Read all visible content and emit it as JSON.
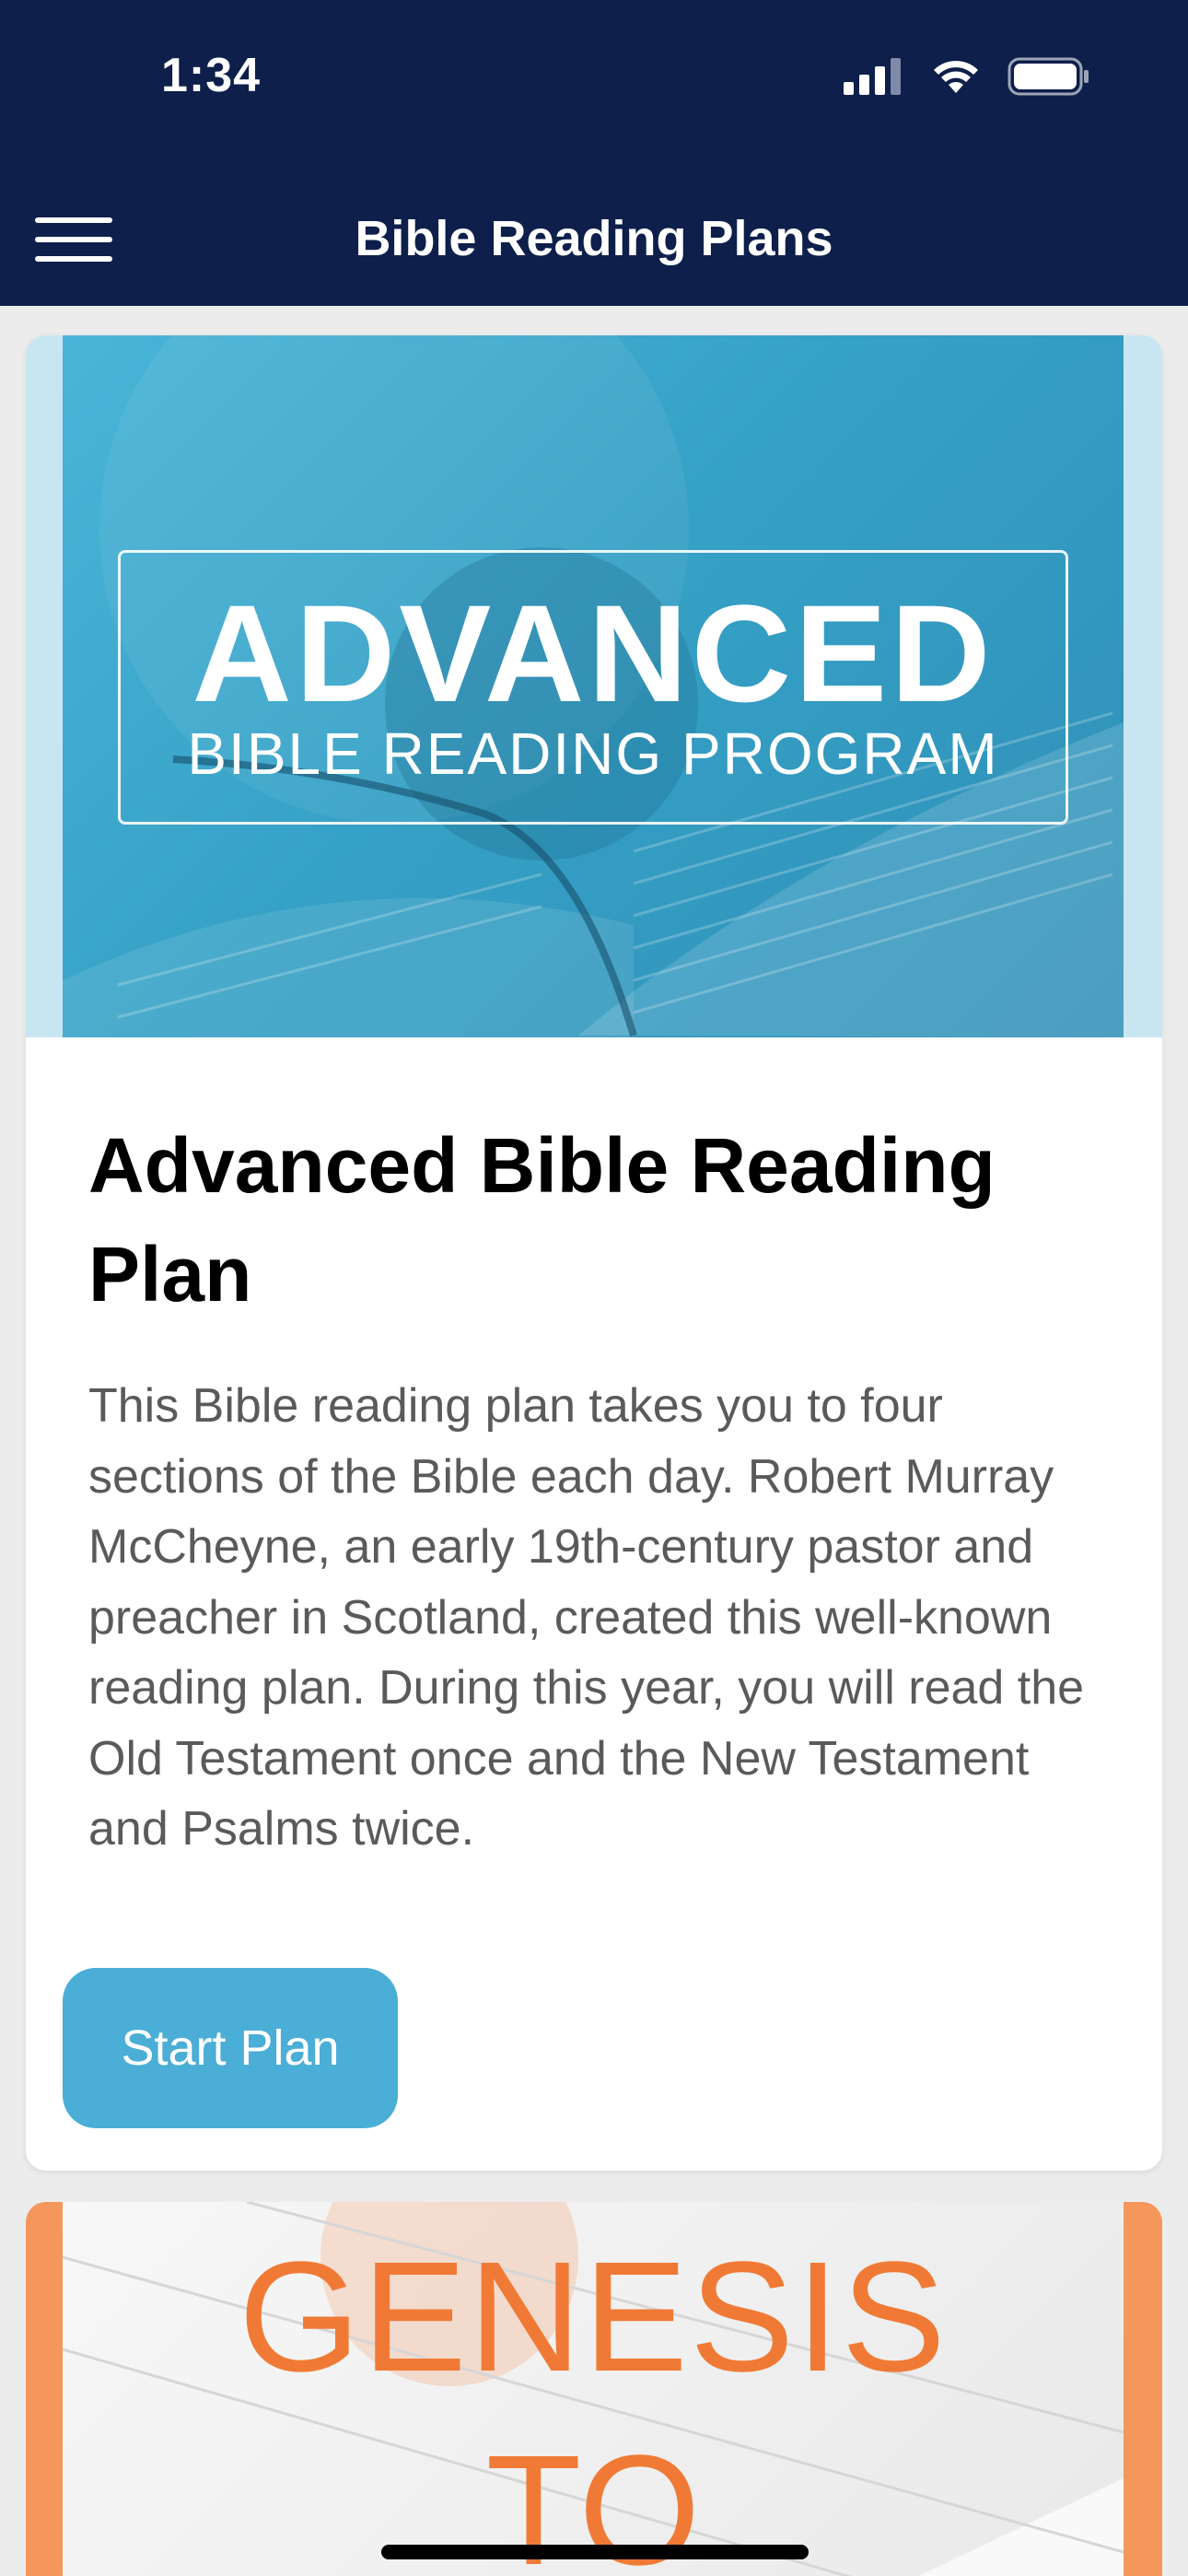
{
  "status_bar": {
    "time": "1:34"
  },
  "header": {
    "title": "Bible Reading Plans"
  },
  "plans": [
    {
      "banner_title": "ADVANCED",
      "banner_subtitle": "BIBLE READING PROGRAM",
      "title": "Advanced Bible Reading Plan",
      "description": "This Bible reading plan takes you to four sections of the Bible each day. Robert Murray McCheyne, an early 19th-century pastor and preacher in Scotland, created this well-known reading plan. During this year, you will read the Old Testament once and the New Testament and Psalms twice.",
      "button_label": "Start Plan",
      "accent_color": "#4aaed6"
    },
    {
      "banner_title_line1": "GENESIS",
      "banner_title_line2": "TO",
      "accent_color": "#f07a35"
    }
  ],
  "colors": {
    "header_bg": "#0d1f4a",
    "page_bg": "#ececec"
  }
}
